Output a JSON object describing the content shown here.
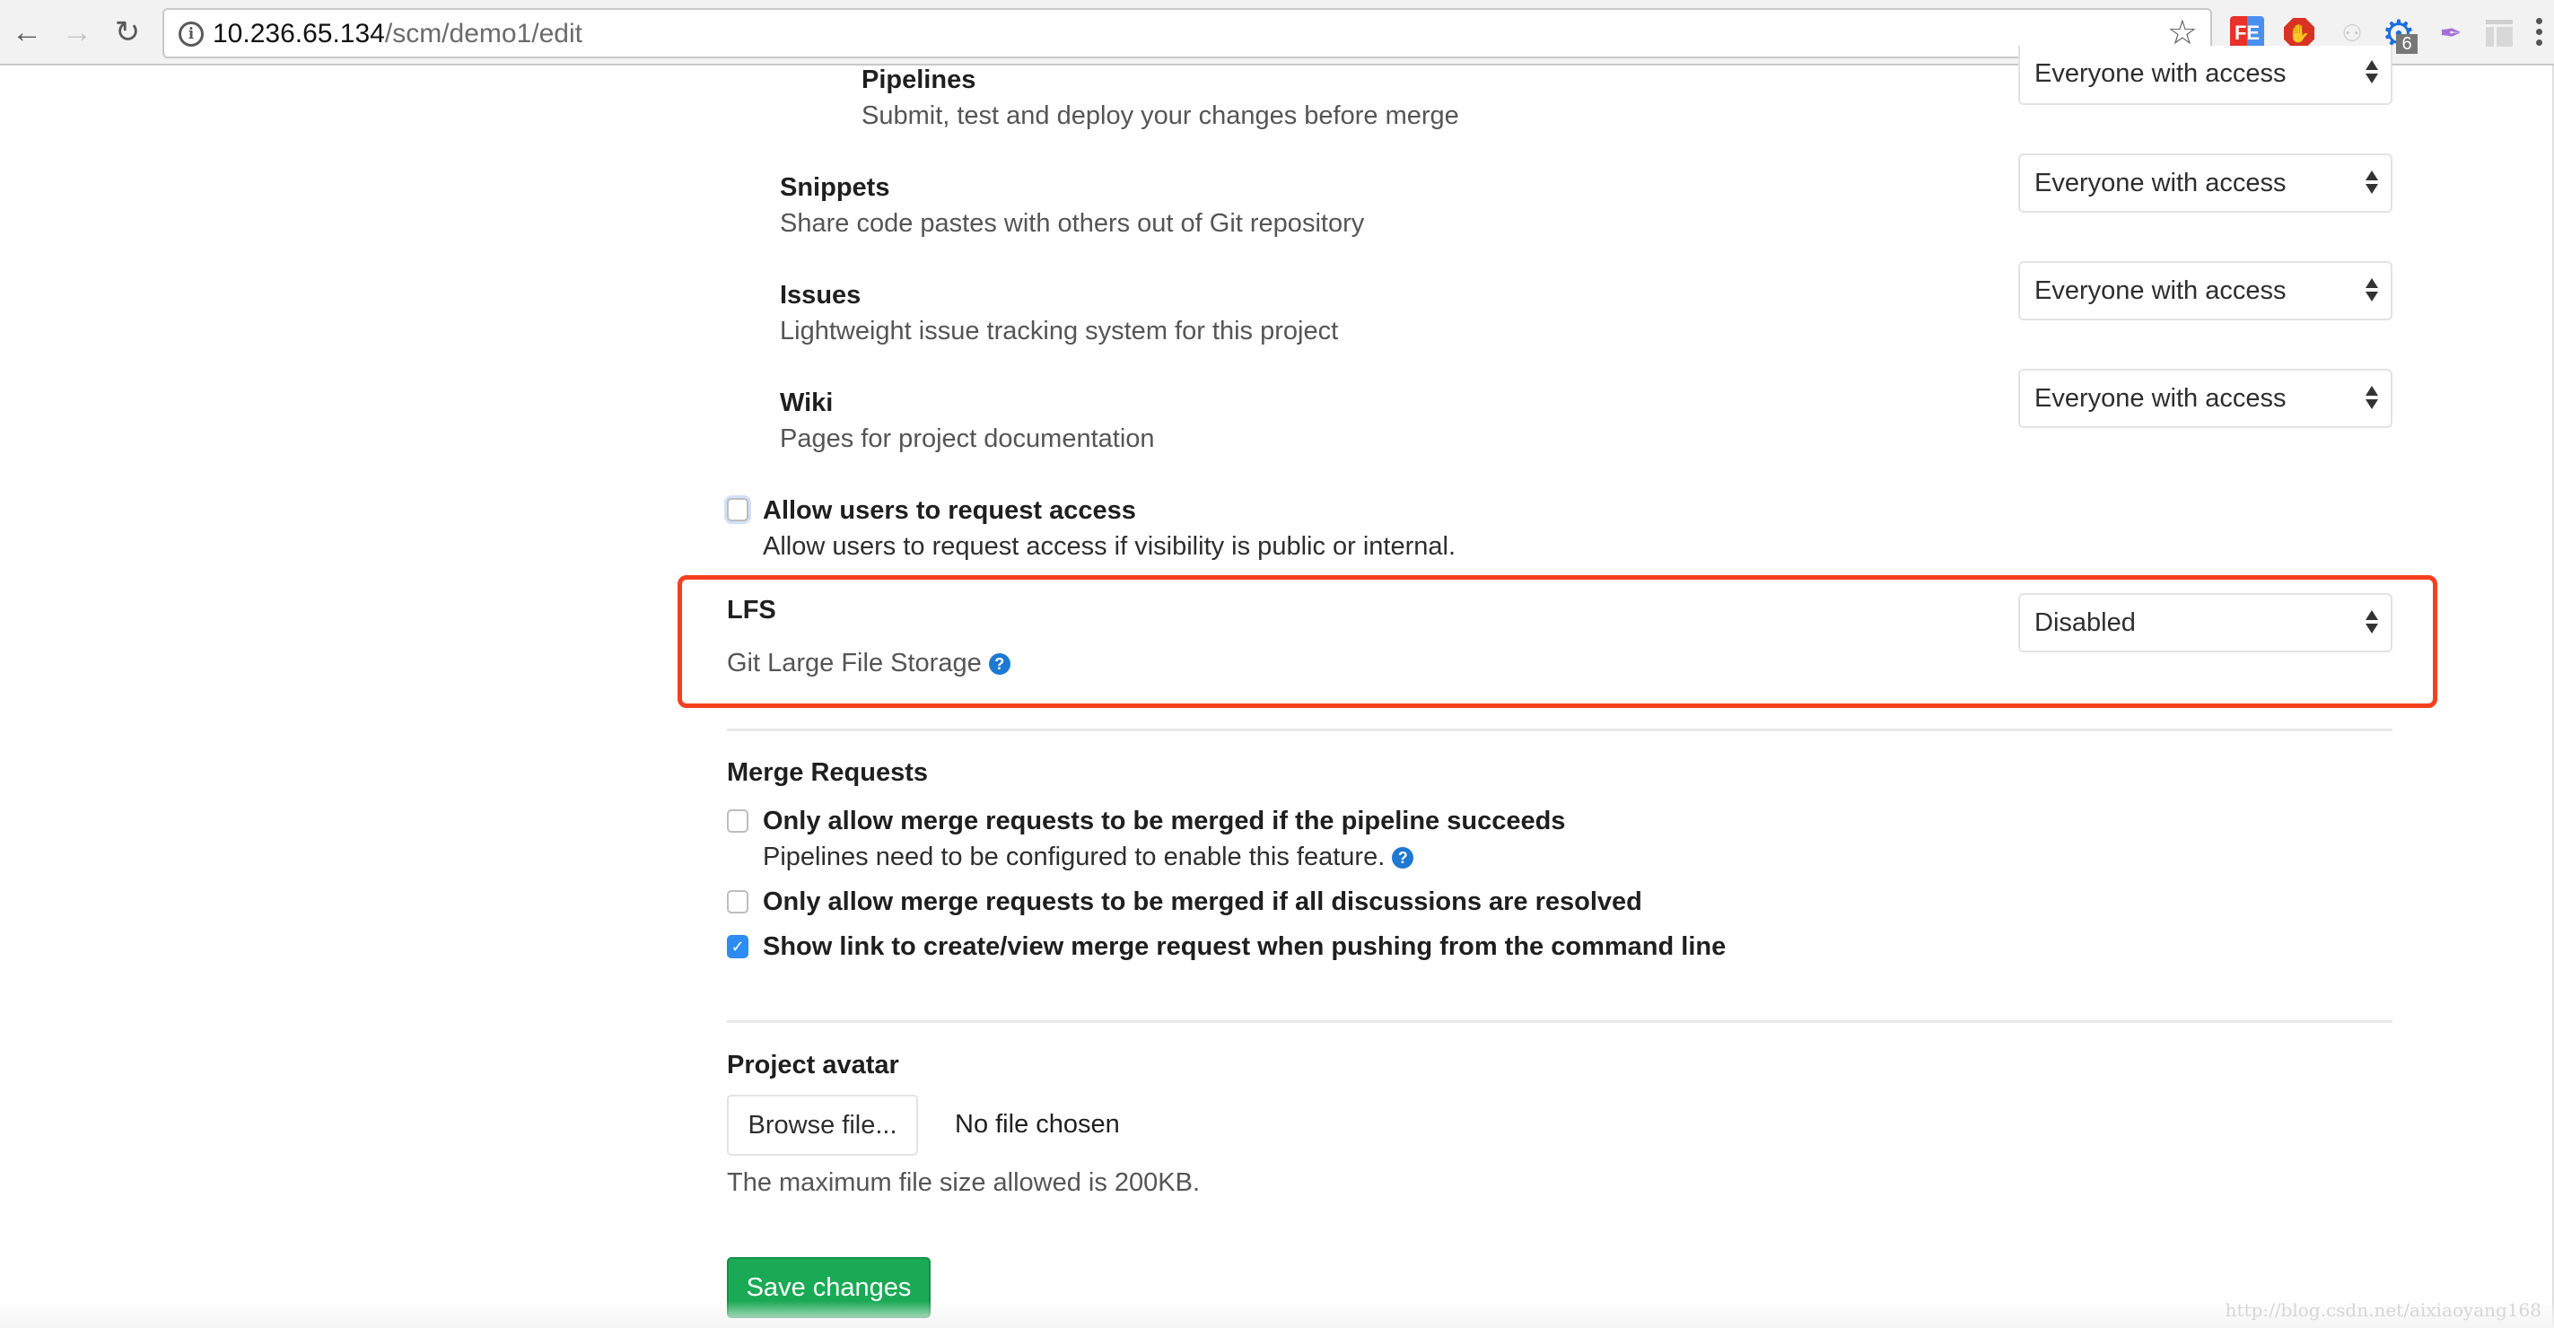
{
  "browser": {
    "url_host": "10.236.65.134",
    "url_path": "/scm/demo1/edit",
    "extensions": [
      {
        "name": "fe-helper",
        "label": "FE"
      },
      {
        "name": "adblock",
        "label": "✋"
      },
      {
        "name": "sitemap",
        "label": "⚇"
      },
      {
        "name": "gear-extension",
        "label": "⚙",
        "badge": "6"
      },
      {
        "name": "quill",
        "label": "✒"
      },
      {
        "name": "layout",
        "label": ""
      }
    ]
  },
  "features": [
    {
      "title": "Pipelines",
      "description": "Submit, test and deploy your changes before merge",
      "access": "Everyone with access"
    },
    {
      "title": "Snippets",
      "description": "Share code pastes with others out of Git repository",
      "access": "Everyone with access"
    },
    {
      "title": "Issues",
      "description": "Lightweight issue tracking system for this project",
      "access": "Everyone with access"
    },
    {
      "title": "Wiki",
      "description": "Pages for project documentation",
      "access": "Everyone with access"
    }
  ],
  "request_access": {
    "label": "Allow users to request access",
    "description": "Allow users to request access if visibility is public or internal.",
    "checked": false
  },
  "lfs": {
    "title": "LFS",
    "description": "Git Large File Storage",
    "value": "Disabled",
    "highlight_color": "#f4401f"
  },
  "merge_requests": {
    "title": "Merge Requests",
    "options": [
      {
        "label": "Only allow merge requests to be merged if the pipeline succeeds",
        "help": "Pipelines need to be configured to enable this feature.",
        "checked": false
      },
      {
        "label": "Only allow merge requests to be merged if all discussions are resolved",
        "checked": false
      },
      {
        "label": "Show link to create/view merge request when pushing from the command line",
        "checked": true
      }
    ]
  },
  "avatar": {
    "title": "Project avatar",
    "browse_label": "Browse file...",
    "file_status": "No file chosen",
    "hint": "The maximum file size allowed is 200KB."
  },
  "save_label": "Save changes",
  "save_color": "#1aaa55",
  "watermark": "http://blog.csdn.net/aixiaoyang168"
}
